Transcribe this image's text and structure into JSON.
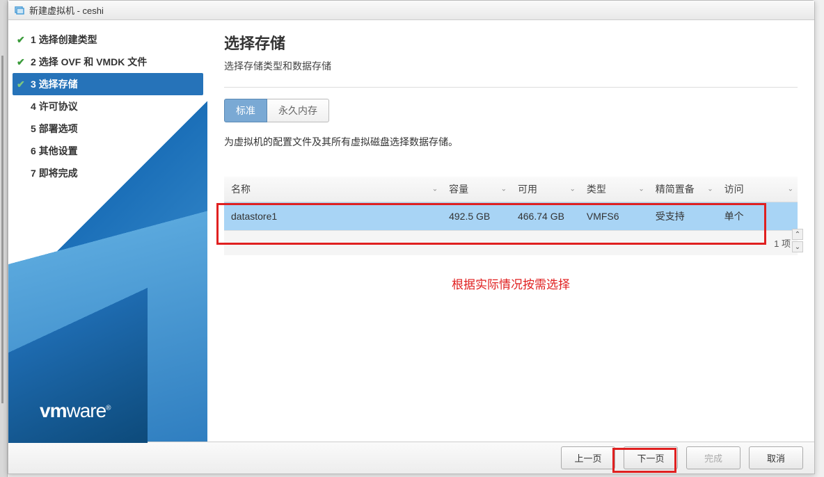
{
  "window": {
    "title": "新建虚拟机 - ceshi"
  },
  "sidebar": {
    "steps": [
      {
        "num": "1",
        "label": "选择创建类型",
        "status": "completed"
      },
      {
        "num": "2",
        "label": "选择 OVF 和 VMDK 文件",
        "status": "completed"
      },
      {
        "num": "3",
        "label": "选择存储",
        "status": "active"
      },
      {
        "num": "4",
        "label": "许可协议",
        "status": "pending"
      },
      {
        "num": "5",
        "label": "部署选项",
        "status": "pending"
      },
      {
        "num": "6",
        "label": "其他设置",
        "status": "pending"
      },
      {
        "num": "7",
        "label": "即将完成",
        "status": "pending"
      }
    ],
    "logo_text": "vmware"
  },
  "main": {
    "title": "选择存储",
    "subtitle": "选择存储类型和数据存储",
    "tabs": [
      {
        "label": "标准",
        "active": true
      },
      {
        "label": "永久内存",
        "active": false
      }
    ],
    "description": "为虚拟机的配置文件及其所有虚拟磁盘选择数据存储。",
    "table": {
      "headers": [
        "名称",
        "容量",
        "可用",
        "类型",
        "精简置备",
        "访问"
      ],
      "rows": [
        {
          "name": "datastore1",
          "capacity": "492.5 GB",
          "available": "466.74 GB",
          "type": "VMFS6",
          "thin": "受支持",
          "access": "单个"
        }
      ],
      "footer_count": "1 项"
    },
    "annotation": "根据实际情况按需选择"
  },
  "footer": {
    "back": "上一页",
    "next": "下一页",
    "finish": "完成",
    "cancel": "取消"
  }
}
